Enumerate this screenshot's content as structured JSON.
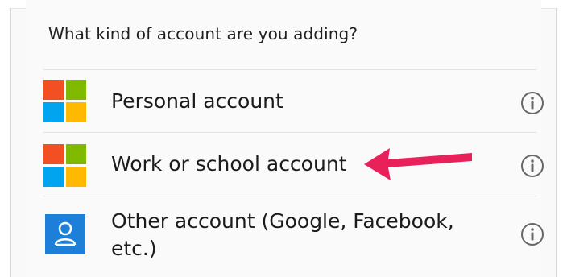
{
  "prompt": {
    "heading": "What kind of account are you adding?"
  },
  "accounts": [
    {
      "label": "Personal account",
      "icon": "microsoft-logo-icon",
      "info_icon": "info-icon"
    },
    {
      "label": "Work or school account",
      "icon": "microsoft-logo-icon",
      "info_icon": "info-icon"
    },
    {
      "label": "Other account (Google, Facebook, etc.)",
      "icon": "person-icon",
      "info_icon": "info-icon"
    }
  ],
  "annotation": {
    "icon": "arrow-pointer-icon",
    "color": "#e8215a"
  },
  "colors": {
    "ms_red": "#f25022",
    "ms_green": "#7fba00",
    "ms_blue": "#00a4ef",
    "ms_yellow": "#ffb900",
    "user_tile_blue": "#1e7fd8"
  }
}
